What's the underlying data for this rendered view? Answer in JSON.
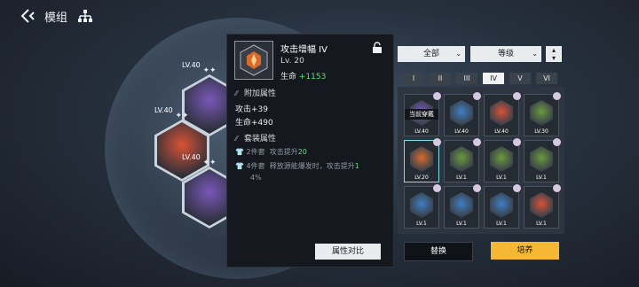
{
  "header": {
    "title": "模组"
  },
  "sphere_modules": [
    {
      "level": "LV.40",
      "color": "#7a58b8"
    },
    {
      "level": "LV.40",
      "color": "#d95236"
    },
    {
      "level": "LV.40",
      "color": "#7a58b8"
    }
  ],
  "detail": {
    "name": "攻击增幅 IV",
    "level": "Lv. 20",
    "hp_label": "生命",
    "hp_bonus": "+1153",
    "extra_title": "附加属性",
    "extra_stats": [
      "攻击+39",
      "生命+490"
    ],
    "set_title": "套装属性",
    "set_rows": [
      {
        "piece": "2件套",
        "text": "攻击提升",
        "value": "20",
        "tail": ""
      },
      {
        "piece": "4件套",
        "text": "释放源能爆发时，攻击提升",
        "value": "1",
        "tail": "4%"
      }
    ],
    "compare_button": "属性对比"
  },
  "filters": {
    "type": "全部",
    "sort": "等级"
  },
  "tiers": {
    "items": [
      "I",
      "II",
      "III",
      "IV",
      "V",
      "VI"
    ],
    "active_index": 3
  },
  "grid": {
    "equipped_label": "当前穿戴",
    "cells": [
      {
        "level": "LV.40",
        "color": "#7a58b8",
        "equipped": true,
        "selected": false
      },
      {
        "level": "LV.40",
        "color": "#3f7fc4",
        "equipped": false,
        "selected": false
      },
      {
        "level": "LV.40",
        "color": "#d95236",
        "equipped": false,
        "selected": false
      },
      {
        "level": "LV.30",
        "color": "#6a9a3c",
        "equipped": false,
        "selected": false
      },
      {
        "level": "LV.20",
        "color": "#d86a2a",
        "equipped": false,
        "selected": true
      },
      {
        "level": "LV.1",
        "color": "#6a9a3c",
        "equipped": false,
        "selected": false
      },
      {
        "level": "LV.1",
        "color": "#6a9a3c",
        "equipped": false,
        "selected": false
      },
      {
        "level": "LV.1",
        "color": "#6a9a3c",
        "equipped": false,
        "selected": false
      },
      {
        "level": "LV.1",
        "color": "#3f7fc4",
        "equipped": false,
        "selected": false
      },
      {
        "level": "LV.1",
        "color": "#3f7fc4",
        "equipped": false,
        "selected": false
      },
      {
        "level": "LV.1",
        "color": "#3f7fc4",
        "equipped": false,
        "selected": false
      },
      {
        "level": "LV.1",
        "color": "#d95236",
        "equipped": false,
        "selected": false
      }
    ]
  },
  "actions": {
    "replace": "替换",
    "train": "培养"
  }
}
